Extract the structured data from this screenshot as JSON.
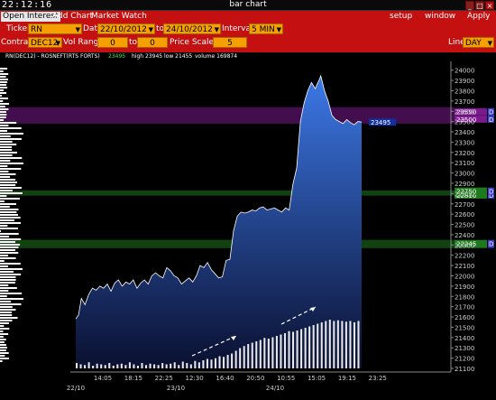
{
  "window": {
    "clock": "22:12:16",
    "title": "bar chart"
  },
  "toolbar": {
    "tabs": [
      "Open Interest",
      "Add Chart",
      "Market Watch"
    ],
    "menus": [
      "setup",
      "window",
      "Apply"
    ]
  },
  "form": {
    "ticker_label": "Ticker",
    "ticker": "RN",
    "date_label": "Date",
    "date_from": "22/10/2012",
    "date_to_label": "to",
    "date_to": "24/10/2012",
    "interval_label": "Interval",
    "interval": "5 MIN",
    "contract_label": "Contract",
    "contract": "DEC12",
    "volrange_label": "Vol Range",
    "vol_from": "0",
    "vol_to_label": "to",
    "vol_to": "0",
    "pricescale_label": "Price Scale",
    "price_scale": "5",
    "line_label": "Line",
    "line": "DAY"
  },
  "chart_data": {
    "type": "area",
    "header": "RN(DEC12) - ROSNEFT(RTS FORTS)",
    "last_value": "23495",
    "high_label": "high 23945",
    "low_label": "low 21455",
    "volume_label": "volume 169874",
    "ylim": [
      21100,
      24050
    ],
    "y_ticks": [
      21100,
      21200,
      21300,
      21400,
      21500,
      21600,
      21700,
      21800,
      21900,
      22000,
      22100,
      22200,
      22300,
      22400,
      22500,
      22600,
      22700,
      22800,
      22900,
      23000,
      23100,
      23200,
      23300,
      23400,
      23500,
      23600,
      23700,
      23800,
      23900,
      24000
    ],
    "x_time_ticks": [
      "14:05",
      "18:15",
      "22:25",
      "12:30",
      "16:40",
      "20:50",
      "10:55",
      "15:05",
      "19:15",
      "23:25"
    ],
    "x_date_ticks": [
      "22/10",
      "23/10",
      "24/10"
    ],
    "price_series": [
      {
        "x": 0,
        "y": 21580
      },
      {
        "x": 3,
        "y": 21620
      },
      {
        "x": 6,
        "y": 21780
      },
      {
        "x": 10,
        "y": 21720
      },
      {
        "x": 14,
        "y": 21820
      },
      {
        "x": 18,
        "y": 21880
      },
      {
        "x": 22,
        "y": 21860
      },
      {
        "x": 26,
        "y": 21900
      },
      {
        "x": 30,
        "y": 21880
      },
      {
        "x": 34,
        "y": 21920
      },
      {
        "x": 38,
        "y": 21850
      },
      {
        "x": 42,
        "y": 21930
      },
      {
        "x": 46,
        "y": 21960
      },
      {
        "x": 50,
        "y": 21900
      },
      {
        "x": 54,
        "y": 21940
      },
      {
        "x": 58,
        "y": 21920
      },
      {
        "x": 62,
        "y": 21960
      },
      {
        "x": 66,
        "y": 21880
      },
      {
        "x": 70,
        "y": 21930
      },
      {
        "x": 74,
        "y": 21960
      },
      {
        "x": 78,
        "y": 21920
      },
      {
        "x": 82,
        "y": 22000
      },
      {
        "x": 86,
        "y": 22030
      },
      {
        "x": 90,
        "y": 22000
      },
      {
        "x": 94,
        "y": 21980
      },
      {
        "x": 98,
        "y": 22080
      },
      {
        "x": 102,
        "y": 22050
      },
      {
        "x": 106,
        "y": 22000
      },
      {
        "x": 110,
        "y": 21980
      },
      {
        "x": 114,
        "y": 21920
      },
      {
        "x": 118,
        "y": 21950
      },
      {
        "x": 122,
        "y": 21980
      },
      {
        "x": 126,
        "y": 21940
      },
      {
        "x": 130,
        "y": 22000
      },
      {
        "x": 134,
        "y": 22100
      },
      {
        "x": 138,
        "y": 22080
      },
      {
        "x": 142,
        "y": 22130
      },
      {
        "x": 146,
        "y": 22060
      },
      {
        "x": 150,
        "y": 22020
      },
      {
        "x": 154,
        "y": 21980
      },
      {
        "x": 158,
        "y": 21990
      },
      {
        "x": 162,
        "y": 22150
      },
      {
        "x": 166,
        "y": 22160
      },
      {
        "x": 170,
        "y": 22440
      },
      {
        "x": 174,
        "y": 22580
      },
      {
        "x": 178,
        "y": 22620
      },
      {
        "x": 182,
        "y": 22610
      },
      {
        "x": 186,
        "y": 22620
      },
      {
        "x": 190,
        "y": 22640
      },
      {
        "x": 194,
        "y": 22630
      },
      {
        "x": 198,
        "y": 22660
      },
      {
        "x": 202,
        "y": 22670
      },
      {
        "x": 206,
        "y": 22640
      },
      {
        "x": 210,
        "y": 22650
      },
      {
        "x": 214,
        "y": 22660
      },
      {
        "x": 218,
        "y": 22640
      },
      {
        "x": 222,
        "y": 22620
      },
      {
        "x": 226,
        "y": 22660
      },
      {
        "x": 230,
        "y": 22640
      },
      {
        "x": 234,
        "y": 22890
      },
      {
        "x": 238,
        "y": 23050
      },
      {
        "x": 242,
        "y": 23500
      },
      {
        "x": 246,
        "y": 23680
      },
      {
        "x": 250,
        "y": 23800
      },
      {
        "x": 254,
        "y": 23880
      },
      {
        "x": 258,
        "y": 23820
      },
      {
        "x": 262,
        "y": 23900
      },
      {
        "x": 264,
        "y": 23945
      },
      {
        "x": 268,
        "y": 23800
      },
      {
        "x": 272,
        "y": 23700
      },
      {
        "x": 276,
        "y": 23560
      },
      {
        "x": 280,
        "y": 23520
      },
      {
        "x": 284,
        "y": 23500
      },
      {
        "x": 288,
        "y": 23480
      },
      {
        "x": 292,
        "y": 23520
      },
      {
        "x": 296,
        "y": 23490
      },
      {
        "x": 300,
        "y": 23470
      },
      {
        "x": 304,
        "y": 23500
      },
      {
        "x": 308,
        "y": 23495
      }
    ],
    "volume_series": [
      8,
      6,
      5,
      9,
      4,
      7,
      6,
      5,
      8,
      4,
      6,
      7,
      5,
      9,
      6,
      4,
      8,
      5,
      7,
      6,
      5,
      8,
      6,
      7,
      9,
      5,
      10,
      8,
      6,
      11,
      9,
      12,
      14,
      13,
      15,
      18,
      17,
      20,
      22,
      26,
      30,
      33,
      36,
      38,
      40,
      42,
      45,
      44,
      46,
      48,
      50,
      52,
      55,
      54,
      56,
      58,
      60,
      62,
      64,
      66,
      68,
      70,
      72,
      70,
      71,
      70,
      69,
      70,
      68,
      70
    ],
    "levels": [
      {
        "from": 23480,
        "to": 23640,
        "color": "#7a1a8c",
        "labels": [
          "23590",
          "23500"
        ]
      },
      {
        "from": 22780,
        "to": 22830,
        "color": "#1e7a1e",
        "labels": [
          "22810",
          "22750"
        ]
      },
      {
        "from": 22270,
        "to": 22350,
        "color": "#1e7a1e",
        "labels": [
          "22305",
          "22245"
        ]
      }
    ],
    "annotations": [
      "arrow-1",
      "arrow-2"
    ],
    "profile_color": "#ffffff",
    "area_top_color": "#3c78e6",
    "area_bottom_color": "#0a1030"
  }
}
